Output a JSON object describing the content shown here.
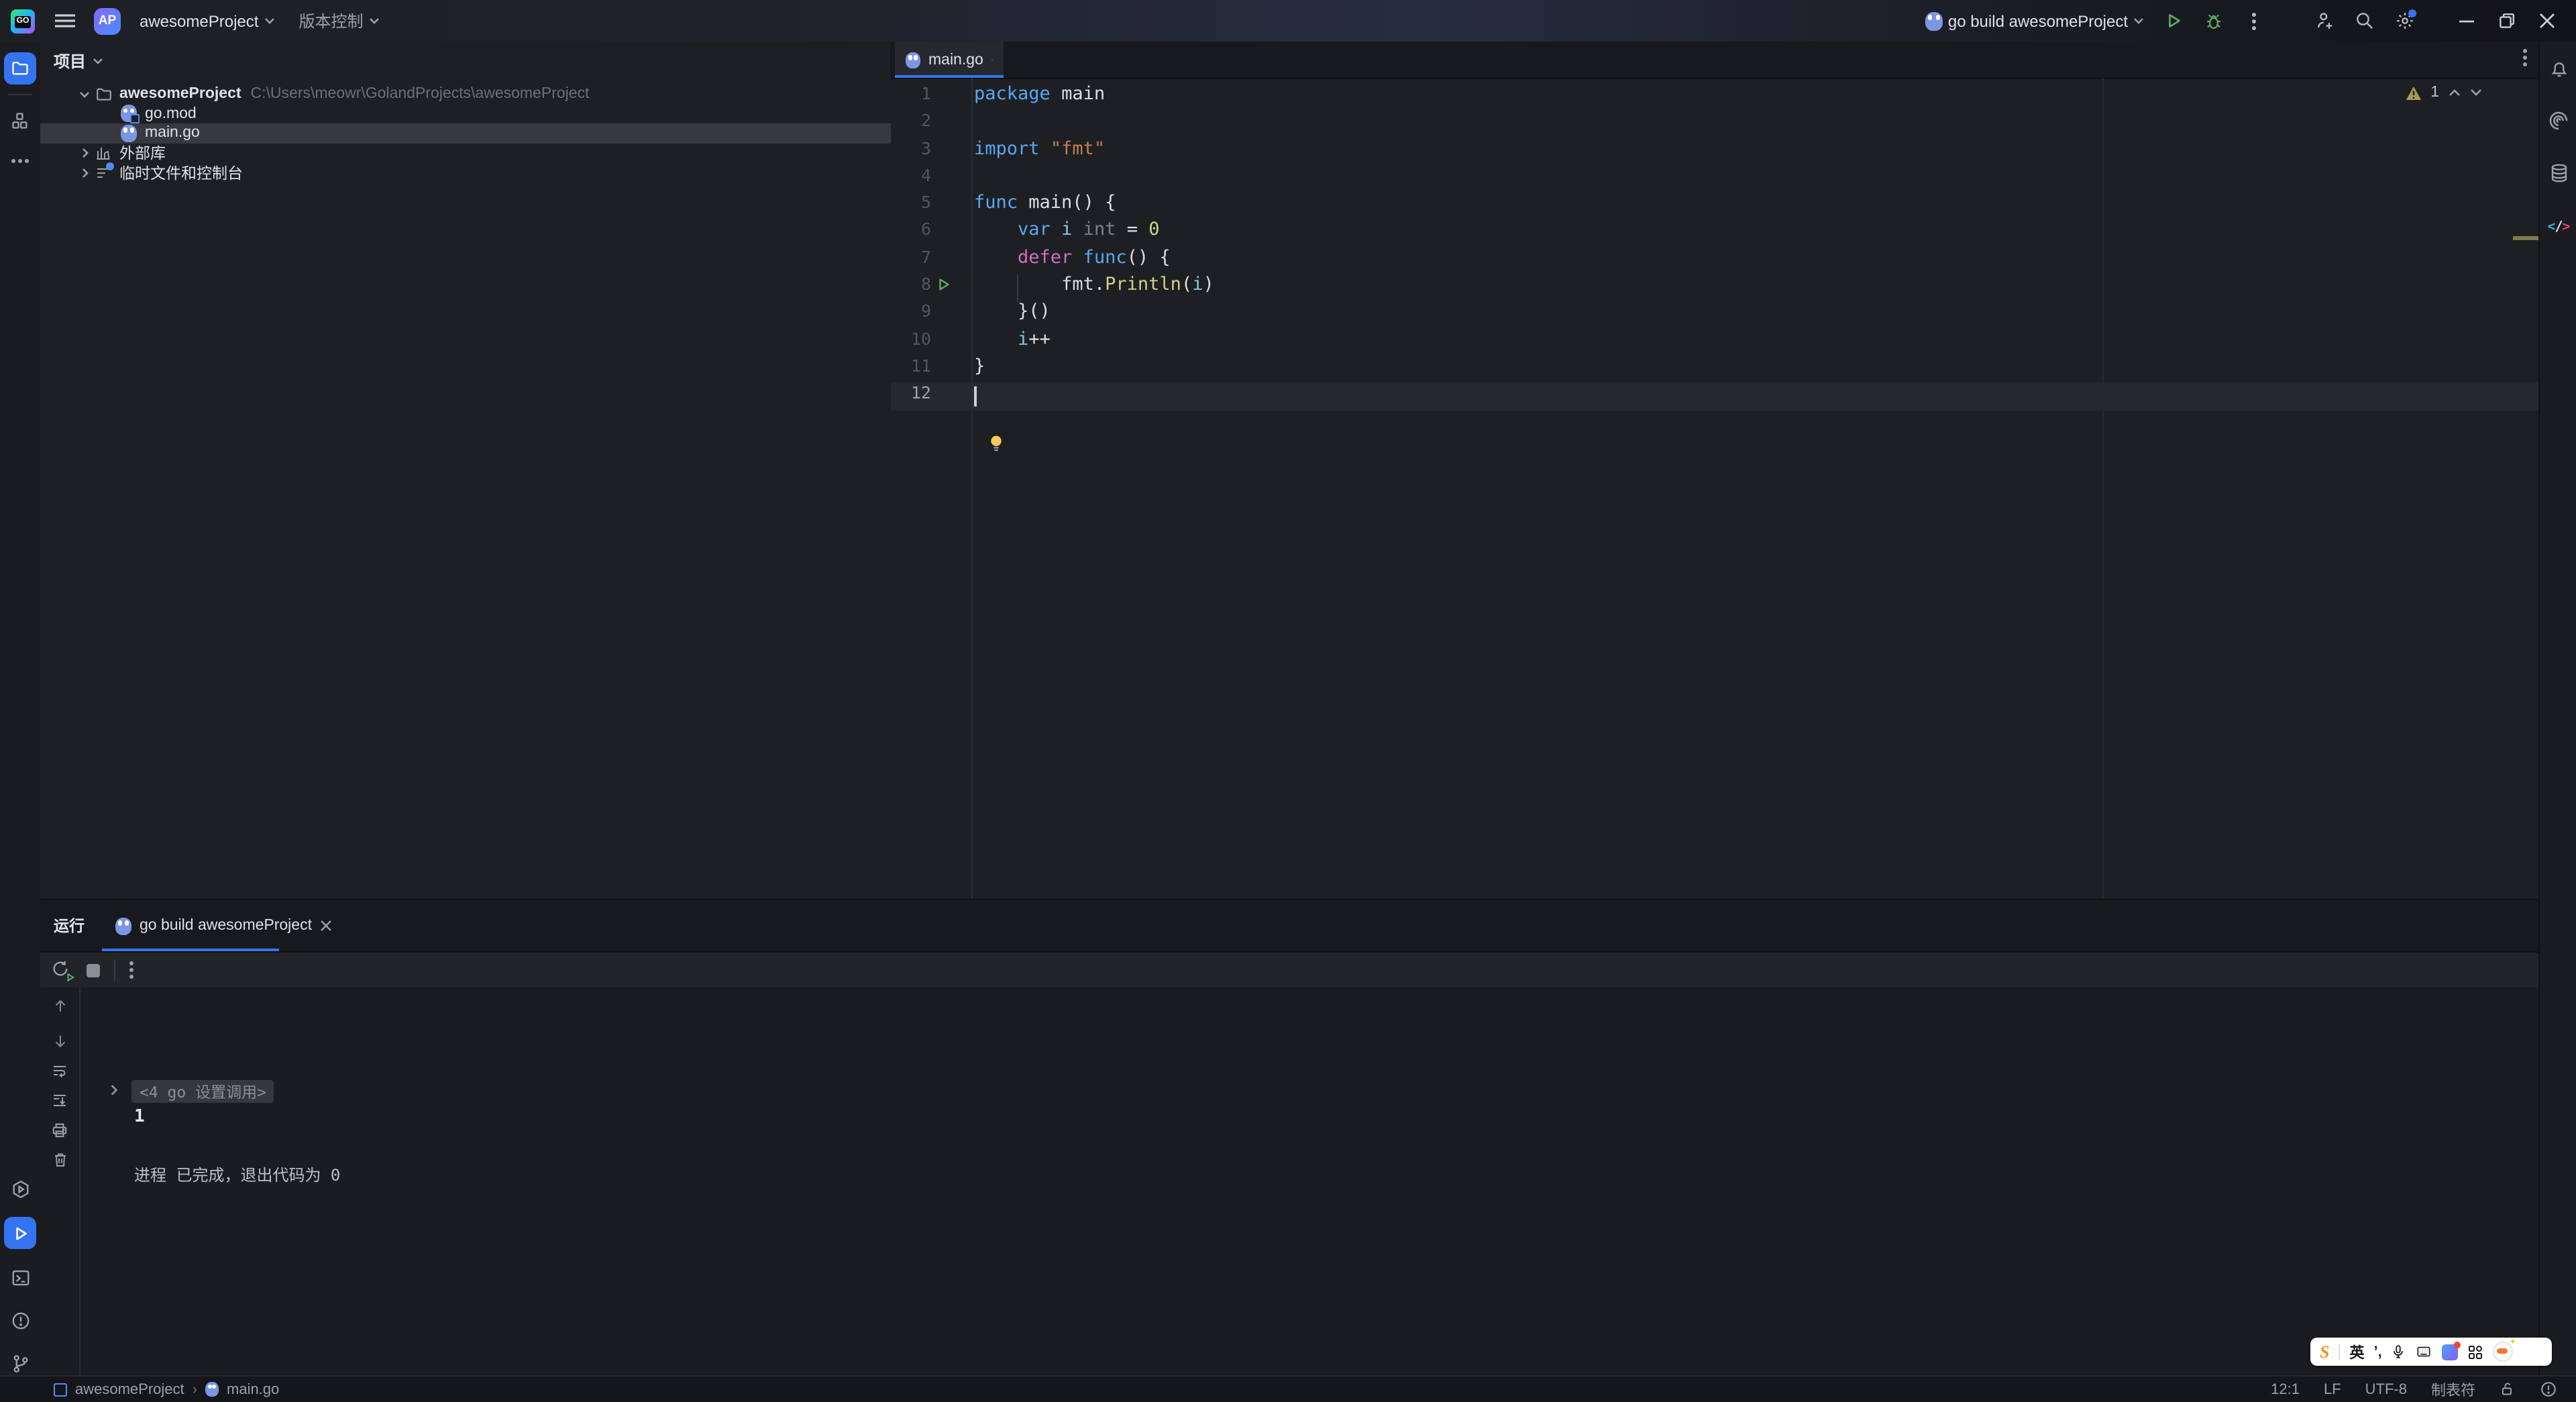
{
  "title_bar": {
    "logo": "GO",
    "project_badge": "AP",
    "project_name": "awesomeProject",
    "vcs_label": "版本控制",
    "run_config": "go build awesomeProject"
  },
  "project_panel": {
    "header": "项目",
    "tree": {
      "root_name": "awesomeProject",
      "root_path": "C:\\Users\\meowr\\GolandProjects\\awesomeProject",
      "file1": "go.mod",
      "file2": "main.go",
      "external_libs": "外部库",
      "scratches": "临时文件和控制台"
    }
  },
  "editor": {
    "tab_label": "main.go",
    "warning_count": "1",
    "code_lines": [
      [
        [
          "kw",
          "package"
        ],
        [
          "pl",
          " main"
        ]
      ],
      [],
      [
        [
          "kw",
          "import"
        ],
        [
          "pl",
          " "
        ],
        [
          "str",
          "\"fmt\""
        ]
      ],
      [],
      [
        [
          "kw",
          "func"
        ],
        [
          "pl",
          " main() {"
        ]
      ],
      [
        [
          "pl",
          "\t"
        ],
        [
          "kw",
          "var"
        ],
        [
          "pl",
          " "
        ],
        [
          "v",
          "i"
        ],
        [
          "pl",
          " "
        ],
        [
          "ty",
          "int"
        ],
        [
          "pl",
          " = "
        ],
        [
          "num",
          "0"
        ]
      ],
      [
        [
          "pl",
          "\t"
        ],
        [
          "ctl",
          "defer"
        ],
        [
          "pl",
          " "
        ],
        [
          "kw",
          "func"
        ],
        [
          "pl",
          "() {"
        ]
      ],
      [
        [
          "pl",
          "\t\t"
        ],
        [
          "pl",
          "fmt."
        ],
        [
          "fn",
          "Println"
        ],
        [
          "pl",
          "("
        ],
        [
          "v",
          "i"
        ],
        [
          "pl",
          ")"
        ]
      ],
      [
        [
          "pl",
          "\t}()"
        ]
      ],
      [
        [
          "pl",
          "\t"
        ],
        [
          "v",
          "i"
        ],
        [
          "pl",
          "++"
        ]
      ],
      [
        [
          "pl",
          "}"
        ]
      ],
      []
    ]
  },
  "run_panel": {
    "title": "运行",
    "tab_label": "go build awesomeProject",
    "console": {
      "fold_line": "<4 go 设置调用>",
      "output": "1",
      "exit_message": "进程 已完成，退出代码为 0"
    }
  },
  "status_bar": {
    "breadcrumb_project": "awesomeProject",
    "breadcrumb_separator": "›",
    "breadcrumb_file": "main.go",
    "caret_position": "12:1",
    "line_ending": "LF",
    "encoding": "UTF-8",
    "indent_style": "制表符"
  },
  "ime_bar": {
    "logo": "S",
    "lang_mode": "英",
    "punct": "’,"
  },
  "colors": {
    "accent_blue": "#3574F0",
    "run_green": "#5FAD65",
    "warning_olive": "#A89C55",
    "gopher_blue": "#7C96E4",
    "sogou_orange": "#F7941D",
    "selection_row": "#37393E"
  }
}
